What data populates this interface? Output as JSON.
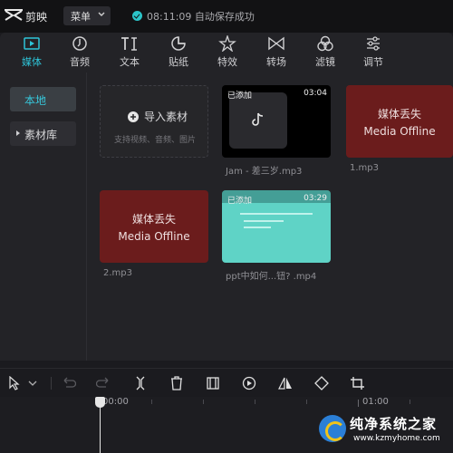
{
  "titlebar": {
    "app_name": "剪映",
    "menu_label": "菜单",
    "save_status": "08:11:09 自动保存成功"
  },
  "tabs": [
    {
      "label": "媒体",
      "icon": "media-icon",
      "active": true
    },
    {
      "label": "音频",
      "icon": "audio-icon"
    },
    {
      "label": "文本",
      "icon": "text-icon"
    },
    {
      "label": "贴纸",
      "icon": "sticker-icon"
    },
    {
      "label": "特效",
      "icon": "effects-icon"
    },
    {
      "label": "转场",
      "icon": "transition-icon"
    },
    {
      "label": "滤镜",
      "icon": "filter-icon"
    },
    {
      "label": "调节",
      "icon": "adjust-icon"
    }
  ],
  "sidebar": {
    "items": [
      {
        "label": "本地",
        "active": true
      },
      {
        "label": "素材库"
      }
    ]
  },
  "media": {
    "import": {
      "label": "导入素材",
      "hint": "支持视频、音频、图片"
    },
    "items": [
      {
        "name": "Jam - 差三岁.mp3",
        "badge": "已添加",
        "duration": "03:04",
        "kind": "audio"
      },
      {
        "name": "1.mp3",
        "status_zh": "媒体丢失",
        "status_en": "Media Offline",
        "kind": "offline"
      },
      {
        "name": "2.mp3",
        "status_zh": "媒体丢失",
        "status_en": "Media Offline",
        "kind": "offline"
      },
      {
        "name": "ppt中如何...钮? .mp4",
        "badge": "已添加",
        "duration": "03:29",
        "kind": "video"
      }
    ]
  },
  "timeline": {
    "tools": [
      "select-icon",
      "undo-icon",
      "redo-icon",
      "split-icon",
      "delete-icon",
      "freeze-frame-icon",
      "play-speed-icon",
      "mirror-icon",
      "rotate-icon",
      "crop-icon"
    ],
    "ruler": {
      "start": "00:00",
      "mark": "01:00"
    }
  },
  "watermark": {
    "name": "纯净系统之家",
    "url": "www.kzmyhome.com"
  },
  "colors": {
    "accent": "#2ec4d8",
    "offline_bg": "#6b1c1c",
    "video_thumb": "#5fd3c6"
  }
}
